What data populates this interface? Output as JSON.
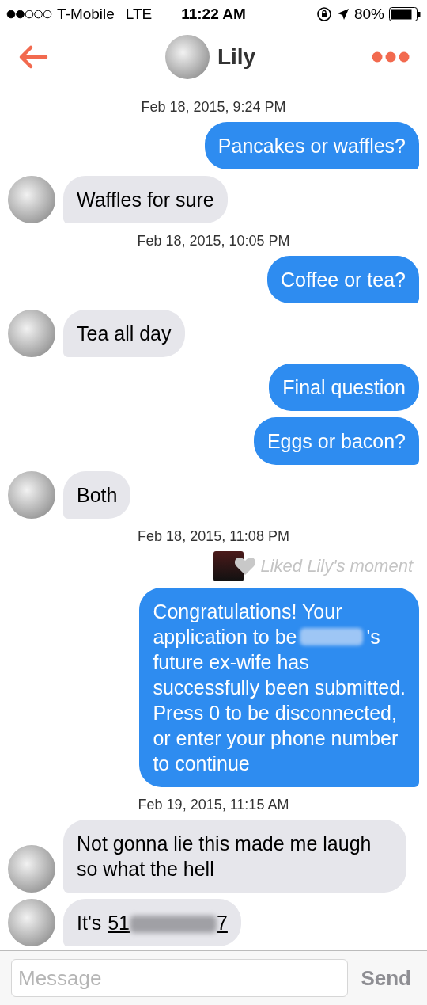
{
  "status_bar": {
    "carrier": "T-Mobile",
    "network": "LTE",
    "time": "11:22 AM",
    "battery": "80%"
  },
  "header": {
    "name": "Lily"
  },
  "messages": [
    {
      "kind": "timestamp",
      "text": "Feb 18, 2015, 9:24 PM"
    },
    {
      "kind": "sent",
      "text": "Pancakes or waffles?",
      "tail": true
    },
    {
      "kind": "received",
      "text": "Waffles for sure"
    },
    {
      "kind": "timestamp",
      "text": "Feb 18, 2015, 10:05 PM"
    },
    {
      "kind": "sent",
      "text": "Coffee or tea?",
      "tail": true
    },
    {
      "kind": "received",
      "text": "Tea all day"
    },
    {
      "kind": "sent",
      "text": "Final question",
      "tail": false
    },
    {
      "kind": "sent",
      "text": "Eggs or bacon?",
      "tail": true
    },
    {
      "kind": "received",
      "text": "Both"
    },
    {
      "kind": "timestamp",
      "text": "Feb 18, 2015, 11:08 PM"
    },
    {
      "kind": "liked",
      "text": "Liked Lily's moment"
    },
    {
      "kind": "sent_redacted",
      "tail": true,
      "lines": [
        {
          "text": "Congratulations! Your"
        },
        {
          "text": "application to be",
          "redacted": true,
          "after": "'s"
        },
        {
          "text": "future ex-wife has"
        },
        {
          "text": "successfully been submitted."
        },
        {
          "text": "Press 0 to be disconnected,"
        },
        {
          "text": "or enter your phone number"
        },
        {
          "text": "to continue"
        }
      ]
    },
    {
      "kind": "timestamp",
      "text": "Feb 19, 2015, 11:15 AM"
    },
    {
      "kind": "received",
      "text": "Not gonna lie this made me laugh so what the hell"
    },
    {
      "kind": "received_phone",
      "text": "It's",
      "link_start": "51",
      "link_end": "7"
    }
  ],
  "composer": {
    "placeholder": "Message",
    "send": "Send"
  }
}
